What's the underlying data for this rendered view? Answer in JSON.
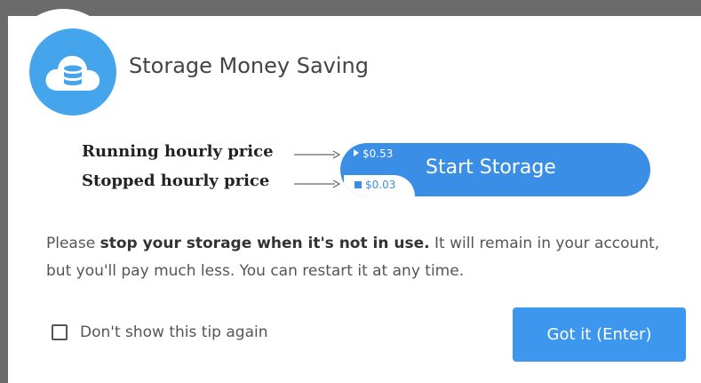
{
  "dialog": {
    "title": "Storage Money Saving",
    "logo_icon": "cloud-database-icon",
    "accent_color": "#3a8ee6"
  },
  "pricing": {
    "running_label": "Running hourly price",
    "stopped_label": "Stopped hourly price",
    "running_price": "$0.53",
    "stopped_price": "$0.03",
    "start_button_label": "Start Storage"
  },
  "message": {
    "part1": "Please ",
    "bold": "stop your storage when it's not in use.",
    "part2": " It will remain in your account, but you'll pay much less. You can restart it at any time."
  },
  "footer": {
    "checkbox_label": "Don't show this tip again",
    "checkbox_checked": false,
    "confirm_button_label": "Got it (Enter)"
  }
}
